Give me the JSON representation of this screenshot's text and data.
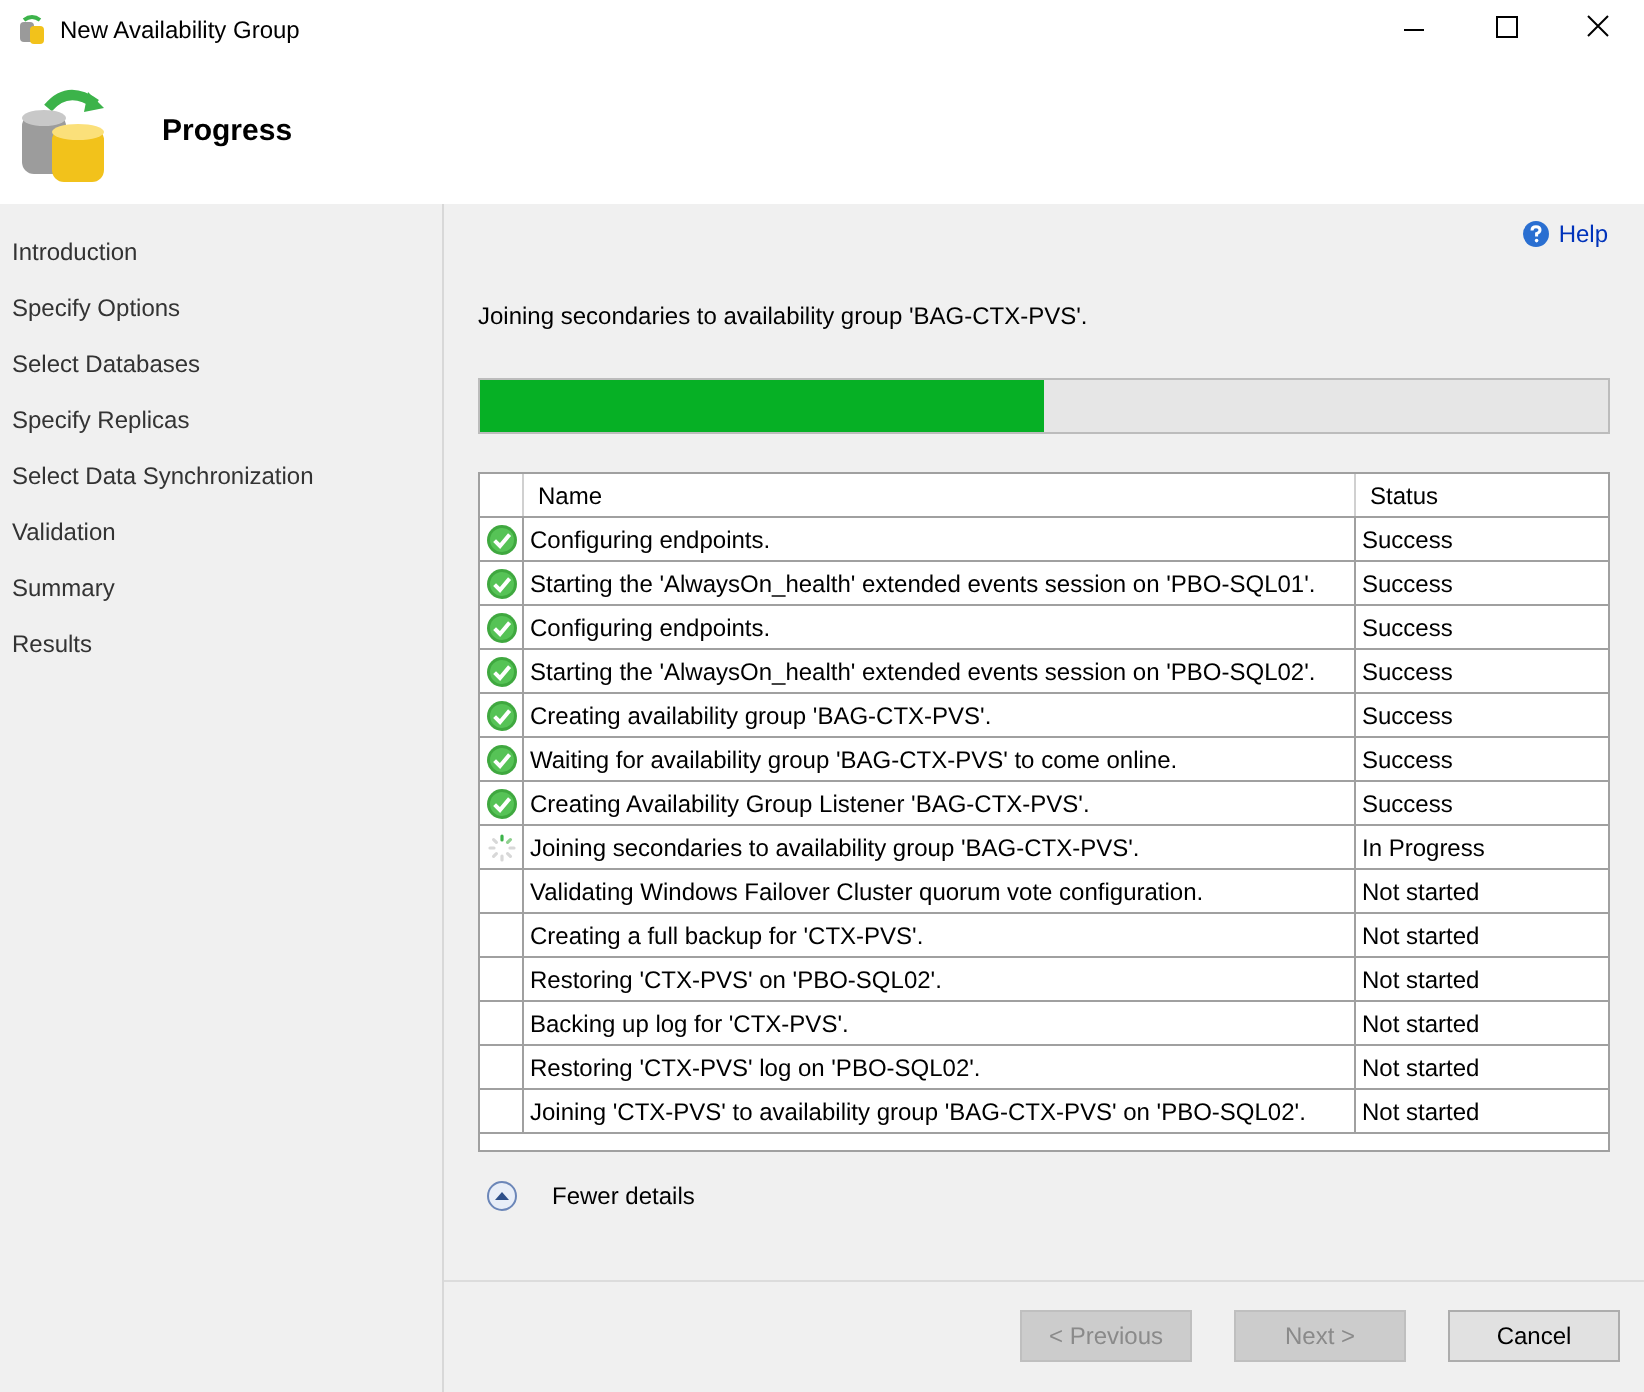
{
  "window": {
    "title": "New Availability Group"
  },
  "header": {
    "title": "Progress"
  },
  "sidebar": {
    "items": [
      {
        "label": "Introduction"
      },
      {
        "label": "Specify Options"
      },
      {
        "label": "Select Databases"
      },
      {
        "label": "Specify Replicas"
      },
      {
        "label": "Select Data Synchronization"
      },
      {
        "label": "Validation"
      },
      {
        "label": "Summary"
      },
      {
        "label": "Results"
      }
    ]
  },
  "help": "Help",
  "status_text": "Joining secondaries to availability group 'BAG-CTX-PVS'.",
  "progress": {
    "level": 0.5
  },
  "table": {
    "columns": [
      "Name",
      "Status"
    ],
    "rows": [
      {
        "kind": "success",
        "name": "Configuring endpoints.",
        "status": "Success"
      },
      {
        "kind": "success",
        "name": "Starting the 'AlwaysOn_health' extended events session on 'PBO-SQL01'.",
        "status": "Success"
      },
      {
        "kind": "success",
        "name": "Configuring endpoints.",
        "status": "Success"
      },
      {
        "kind": "success",
        "name": "Starting the 'AlwaysOn_health' extended events session on 'PBO-SQL02'.",
        "status": "Success"
      },
      {
        "kind": "success",
        "name": "Creating availability group 'BAG-CTX-PVS'.",
        "status": "Success"
      },
      {
        "kind": "success",
        "name": "Waiting for availability group 'BAG-CTX-PVS' to come online.",
        "status": "Success"
      },
      {
        "kind": "success",
        "name": "Creating Availability Group Listener 'BAG-CTX-PVS'.",
        "status": "Success"
      },
      {
        "kind": "in_progress",
        "name": "Joining secondaries to availability group 'BAG-CTX-PVS'.",
        "status": "In Progress"
      },
      {
        "kind": "not_started",
        "name": "Validating Windows Failover Cluster quorum vote configuration.",
        "status": "Not started"
      },
      {
        "kind": "not_started",
        "name": "Creating a full backup for 'CTX-PVS'.",
        "status": "Not started"
      },
      {
        "kind": "not_started",
        "name": "Restoring 'CTX-PVS' on 'PBO-SQL02'.",
        "status": "Not started"
      },
      {
        "kind": "not_started",
        "name": "Backing up log for 'CTX-PVS'.",
        "status": "Not started"
      },
      {
        "kind": "not_started",
        "name": "Restoring 'CTX-PVS' log on 'PBO-SQL02'.",
        "status": "Not started"
      },
      {
        "kind": "not_started",
        "name": "Joining 'CTX-PVS' to availability group 'BAG-CTX-PVS' on 'PBO-SQL02'.",
        "status": "Not started"
      }
    ]
  },
  "details_toggle": "Fewer details",
  "buttons": [
    {
      "label": "< Previous",
      "disabled": true
    },
    {
      "label": "Next >",
      "disabled": true
    },
    {
      "label": "Cancel",
      "disabled": false
    }
  ]
}
